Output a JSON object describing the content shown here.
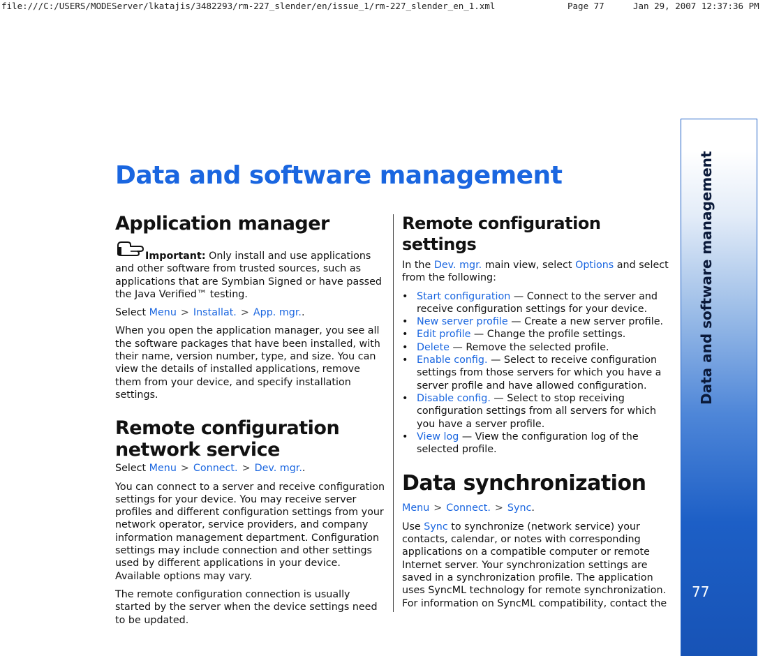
{
  "header": {
    "file_path": "file:///C:/USERS/MODEServer/lkatajis/3482293/rm-227_slender/en/issue_1/rm-227_slender_en_1.xml",
    "page_label": "Page 77",
    "datetime": "Jan 29, 2007 12:37:36 PM"
  },
  "side_tab": {
    "title": "Data and software management",
    "page_number": "77"
  },
  "chapter_title": "Data and software management",
  "app_manager": {
    "heading": "Application manager",
    "important_label": "Important:",
    "important_text": " Only install and use applications and other software from trusted sources, such as applications that are Symbian Signed or have passed the Java Verified™ testing.",
    "select_prefix": "Select ",
    "path": [
      "Menu",
      "Installat.",
      "App. mgr."
    ],
    "path_end": ".",
    "body": "When you open the application manager, you see all the software packages that have been installed, with their name, version number, type, and size. You can view the details of installed applications, remove them from your device, and specify installation settings."
  },
  "remote_network": {
    "heading_line1": "Remote configuration",
    "heading_line2": "network service",
    "select_prefix": "Select ",
    "path": [
      "Menu",
      "Connect.",
      "Dev. mgr."
    ],
    "path_end": ".",
    "body1": "You can connect to a server and receive configuration settings for your device. You may receive server profiles and different configuration settings from your network operator, service providers, and company information management department. Configuration settings may include connection and other settings used by different applications in your device. Available options may vary.",
    "body2": "The remote configuration connection is usually started by the server when the device settings need to be updated."
  },
  "remote_settings": {
    "heading": "Remote configuration settings",
    "intro_prefix": "In the ",
    "intro_link1": "Dev. mgr.",
    "intro_mid": " main view, select ",
    "intro_link2": "Options",
    "intro_suffix": " and select from the following:",
    "bullet": "•",
    "items": [
      {
        "label": "Start configuration",
        "text": " — Connect to the server and receive configuration settings for your device."
      },
      {
        "label": "New server profile",
        "text": " — Create a new server profile."
      },
      {
        "label": "Edit profile",
        "text": " — Change the profile settings."
      },
      {
        "label": "Delete",
        "text": " — Remove the selected profile."
      },
      {
        "label": "Enable config.",
        "text": " — Select to receive configuration settings from those servers for which you have a server profile and have allowed configuration."
      },
      {
        "label": "Disable config.",
        "text": " — Select to stop receiving configuration settings from all servers for which you have a server profile."
      },
      {
        "label": "View log",
        "text": " — View the configuration log of the selected profile."
      }
    ]
  },
  "data_sync": {
    "heading": "Data synchronization",
    "path": [
      "Menu",
      "Connect.",
      "Sync"
    ],
    "path_end": ".",
    "body_prefix": "Use ",
    "body_link": "Sync",
    "body_text": " to synchronize (network service) your contacts, calendar, or notes with corresponding applications on a compatible computer or remote Internet server. Your synchronization settings are saved in a synchronization profile. The application uses SyncML technology for remote synchronization. For information on SyncML compatibility, contact the"
  },
  "path_separator": ">",
  "colors": {
    "link": "#1a66e0",
    "tab": "#1d5fc6"
  }
}
